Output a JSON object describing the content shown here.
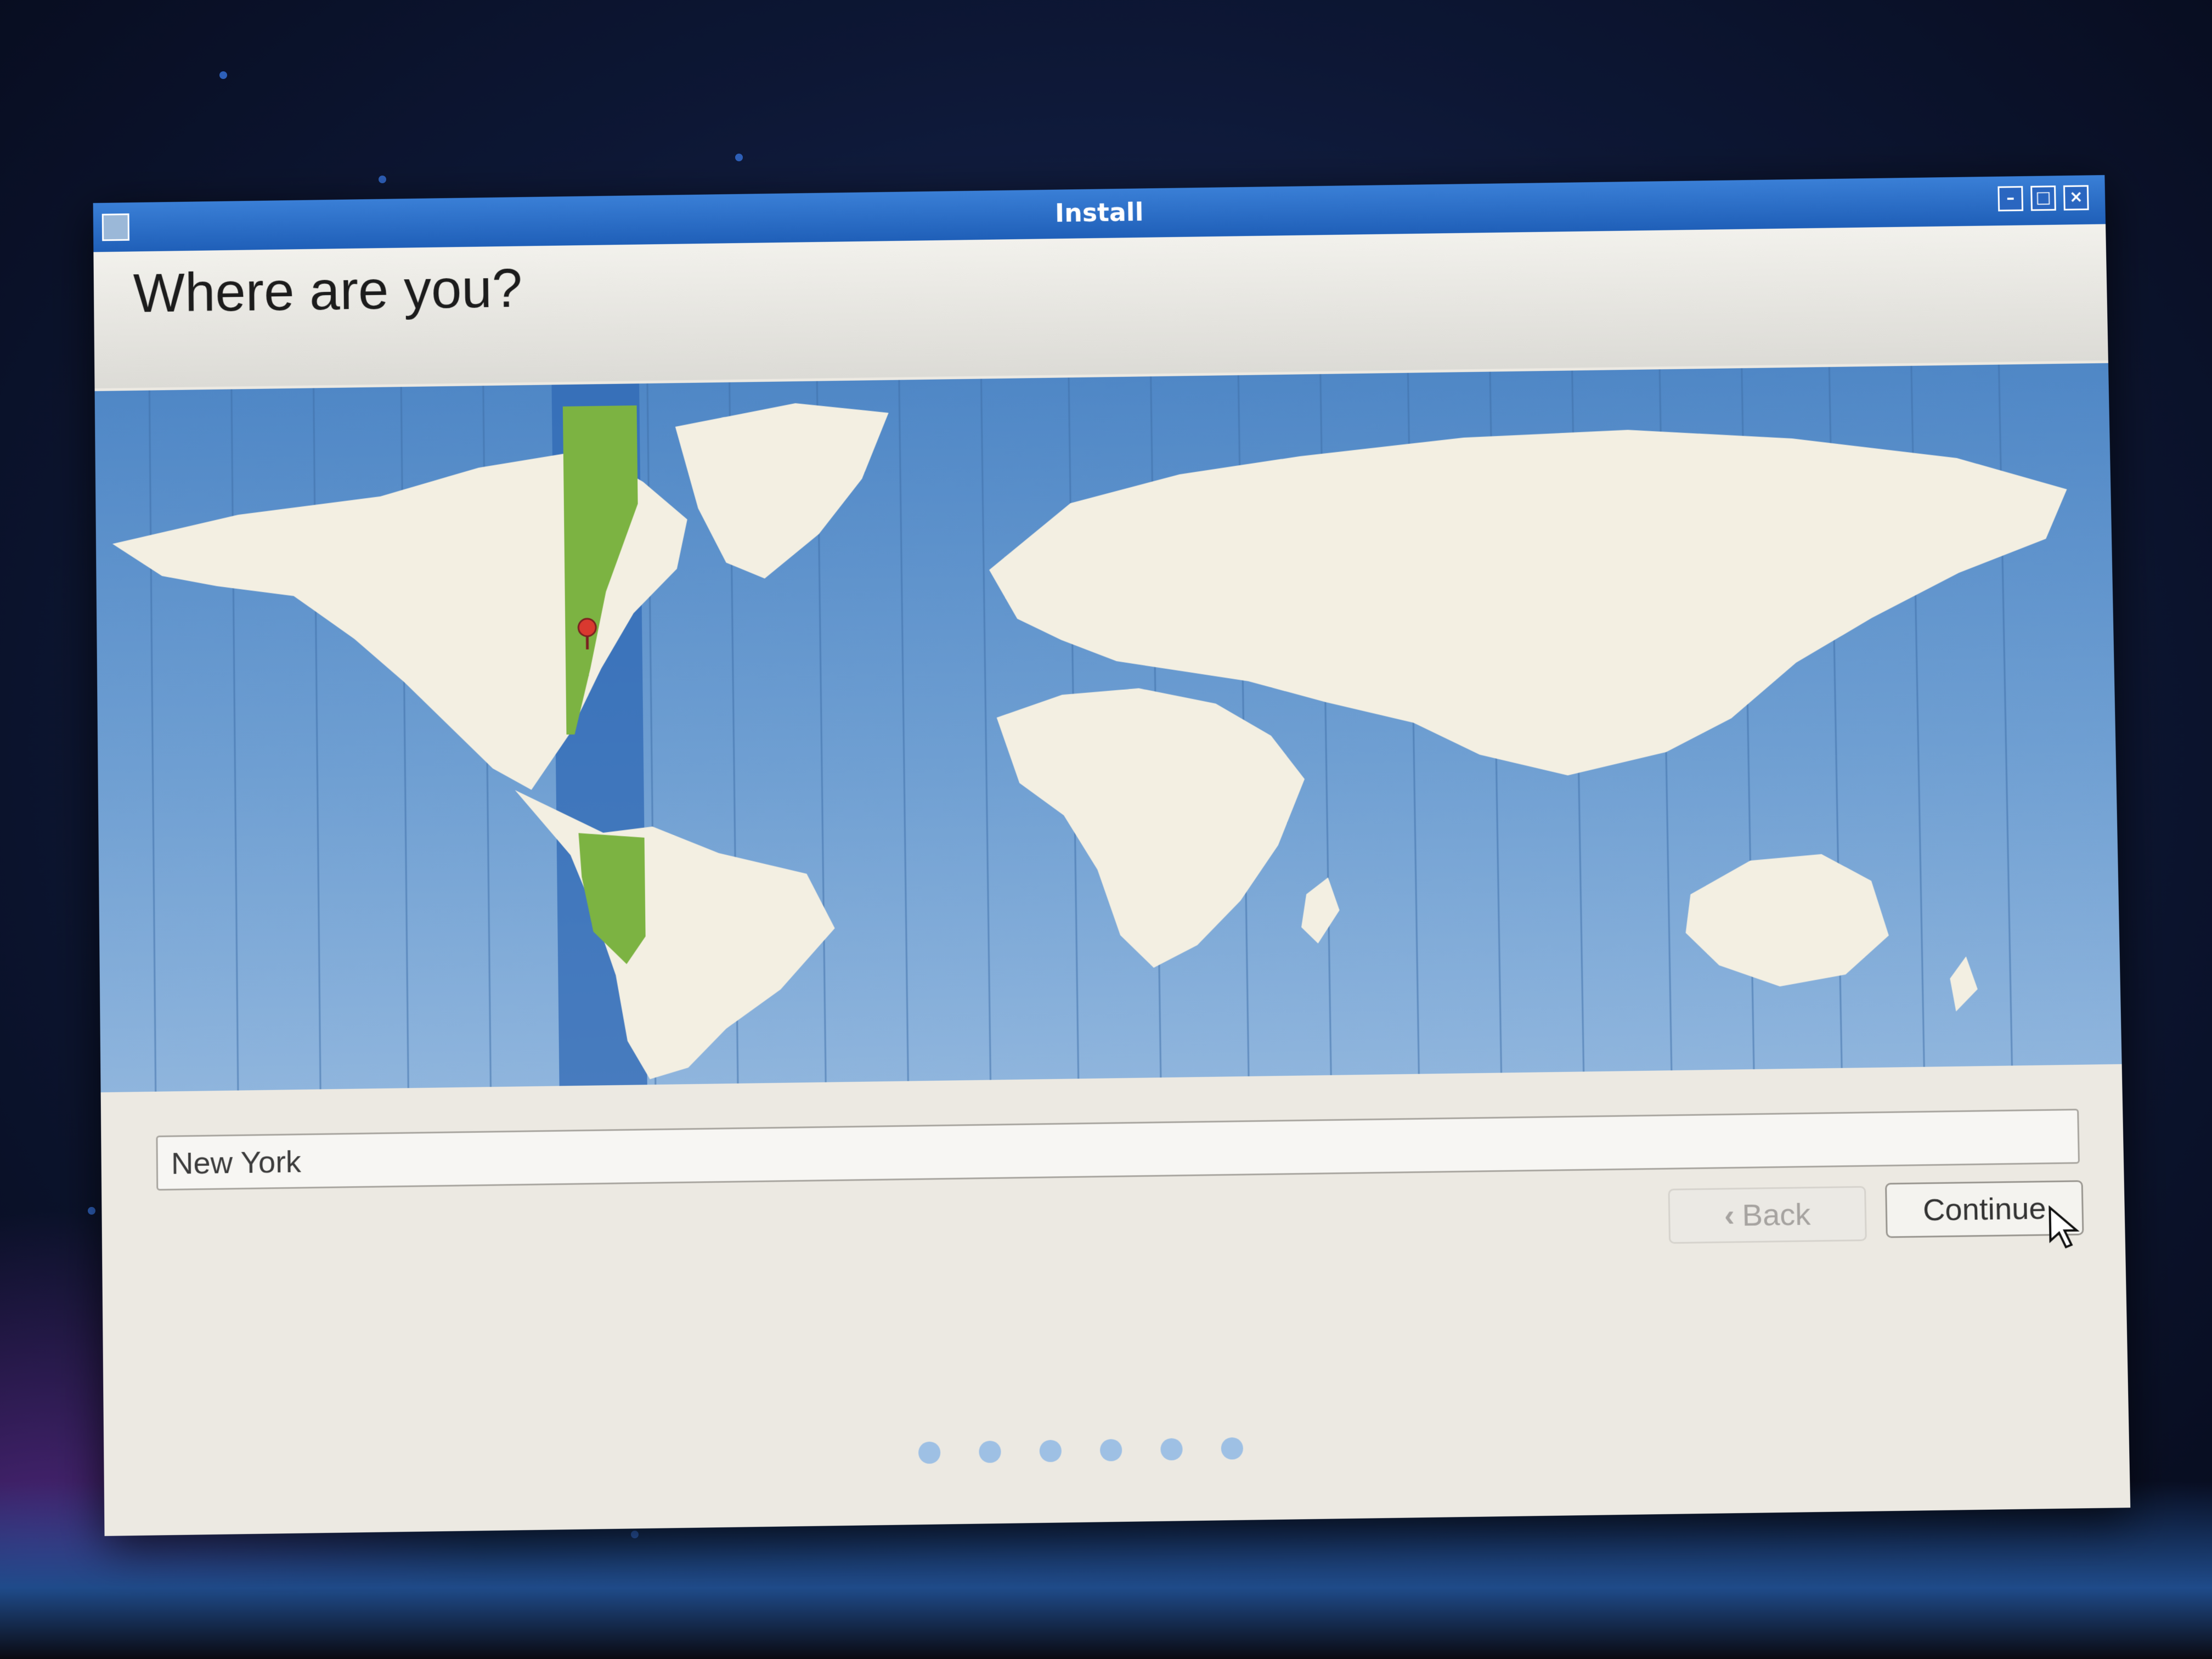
{
  "window": {
    "title": "Install",
    "controls": {
      "minimize": "–",
      "maximize": "□",
      "close": "×"
    }
  },
  "page": {
    "title": "Where are you?"
  },
  "timezone_map": {
    "selected_city_pin": "red-pin",
    "highlight_color": "#7cb342",
    "ocean_color": "#5b8fc9",
    "land_color": "#f3efe2"
  },
  "location": {
    "value": "New York"
  },
  "buttons": {
    "back": "Back",
    "continue": "Continue"
  },
  "progress": {
    "total_steps": 6
  },
  "colors": {
    "titlebar": "#2a66c0",
    "window_bg": "#ece9e2",
    "progress_dot": "#9ec0e4"
  }
}
